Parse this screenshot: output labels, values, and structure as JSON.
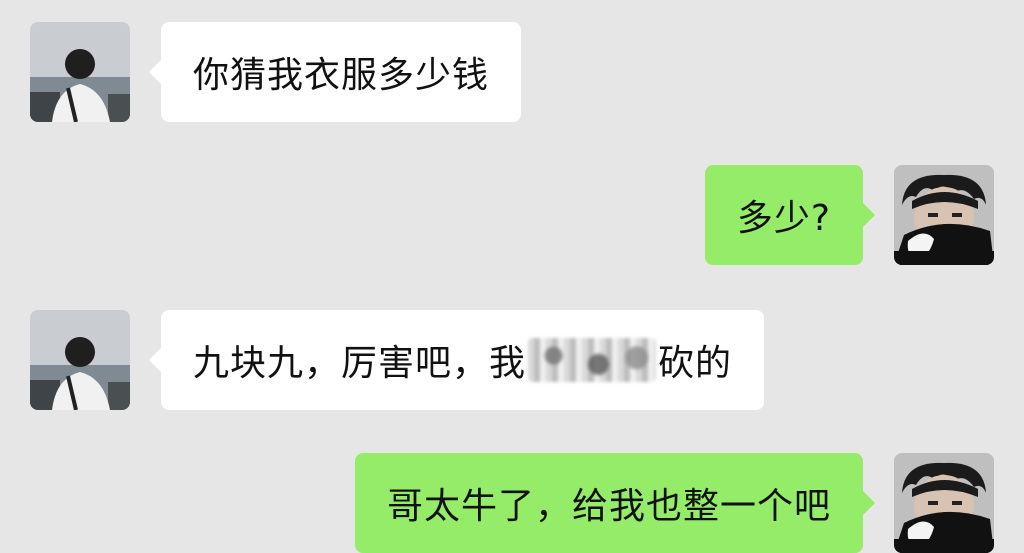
{
  "messages": [
    {
      "side": "incoming",
      "text": "你猜我衣服多少钱",
      "avatar_icon": "user-avatar-back-view-icon"
    },
    {
      "side": "outgoing",
      "text": "多少?",
      "avatar_icon": "user-avatar-face-covered-icon"
    },
    {
      "side": "incoming",
      "text_before": "九块九，厉害吧，我",
      "censored": true,
      "text_after": "砍的",
      "avatar_icon": "user-avatar-back-view-icon"
    },
    {
      "side": "outgoing",
      "text": "哥太牛了，给我也整一个吧",
      "avatar_icon": "user-avatar-face-covered-icon"
    }
  ],
  "colors": {
    "background": "#e6e6e6",
    "incoming_bubble": "#ffffff",
    "outgoing_bubble": "#95ec69"
  }
}
